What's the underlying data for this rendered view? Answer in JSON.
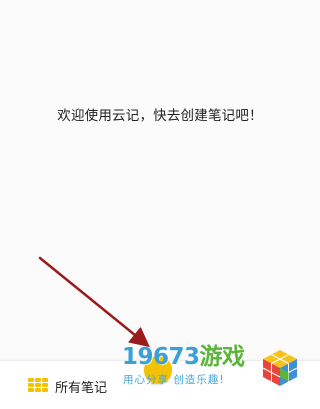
{
  "empty_state": {
    "message": "欢迎使用云记，快去创建笔记吧！"
  },
  "bottom_bar": {
    "all_notes_label": "所有笔记",
    "accent_color": "#f3c200"
  },
  "watermark": {
    "brand_number": "19673",
    "brand_text": "游戏",
    "slogan": "用心分享 创造乐趣!"
  },
  "icons": {
    "all_notes": "grid-icon",
    "new_note": "plus-circle-icon"
  }
}
